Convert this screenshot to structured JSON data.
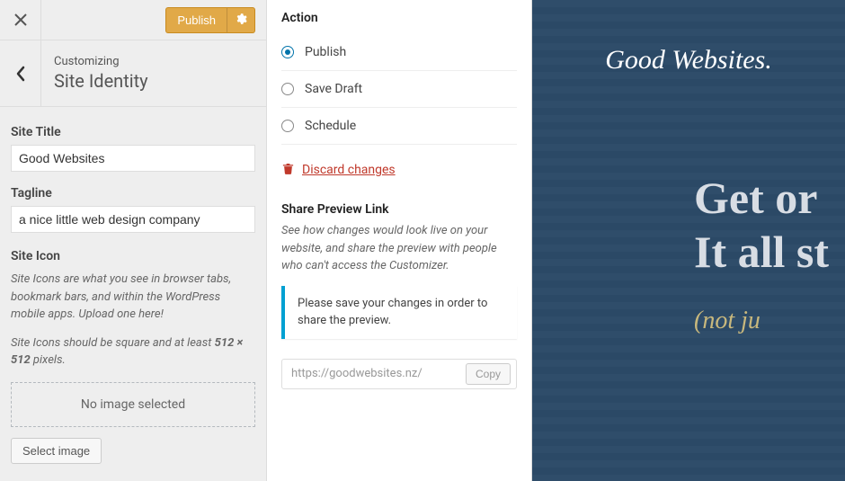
{
  "left": {
    "publish_btn": "Publish",
    "customizing": "Customizing",
    "section_title": "Site Identity",
    "site_title_label": "Site Title",
    "site_title_value": "Good Websites",
    "tagline_label": "Tagline",
    "tagline_value": "a nice little web design company",
    "site_icon_label": "Site Icon",
    "site_icon_desc1": "Site Icons are what you see in browser tabs, bookmark bars, and within the WordPress mobile apps. Upload one here!",
    "site_icon_desc2_a": "Site Icons should be square and at least ",
    "site_icon_desc2_b": "512 × 512",
    "site_icon_desc2_c": " pixels.",
    "no_image": "No image selected",
    "select_image": "Select image"
  },
  "action": {
    "heading": "Action",
    "opts": {
      "publish": "Publish",
      "save_draft": "Save Draft",
      "schedule": "Schedule"
    },
    "discard": "Discard changes",
    "share_heading": "Share Preview Link",
    "share_desc": "See how changes would look live on your website, and share the preview with people who can't access the Customizer.",
    "notice": "Please save your changes in order to share the preview.",
    "url": "https://goodwebsites.nz/",
    "copy": "Copy"
  },
  "preview": {
    "logo": "Good Websites.",
    "hero1": "Get or",
    "hero2": "It all st",
    "sub": "(not ju"
  }
}
